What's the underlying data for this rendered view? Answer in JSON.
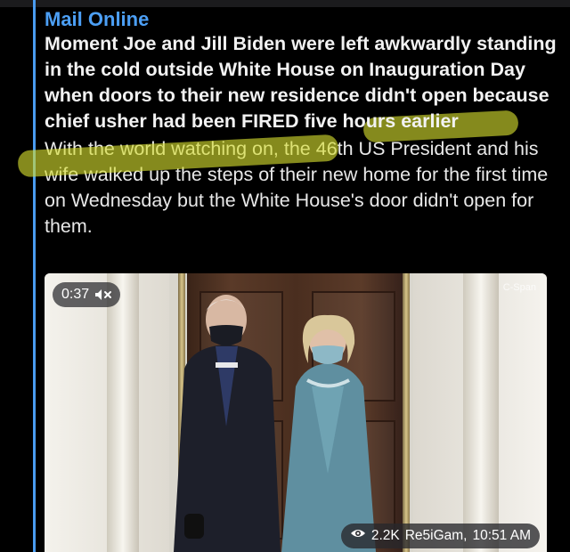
{
  "post": {
    "channel_name": "Mail Online",
    "headline": "Moment Joe and Jill Biden were left awkwardly standing in the cold outside White House on Inauguration Day when doors to their new residence didn't open because chief usher had been FIRED five hours earlier",
    "body": "With the world watching on, the 46th US President and his wife walked up the steps of their new home for the first time on Wednesday but the White House's door didn't open for them."
  },
  "media": {
    "duration": "0:37",
    "muted_icon": "speaker-muted-icon",
    "watermark": "C-Span",
    "views": "2.2K",
    "author": "Re5iGam,",
    "time": "10:51 AM",
    "views_icon": "eye-icon"
  },
  "colors": {
    "channel": "#4c9ff5",
    "quote_bar": "#4a9cf0",
    "highlight": "#d6de2e",
    "background": "#000000"
  }
}
